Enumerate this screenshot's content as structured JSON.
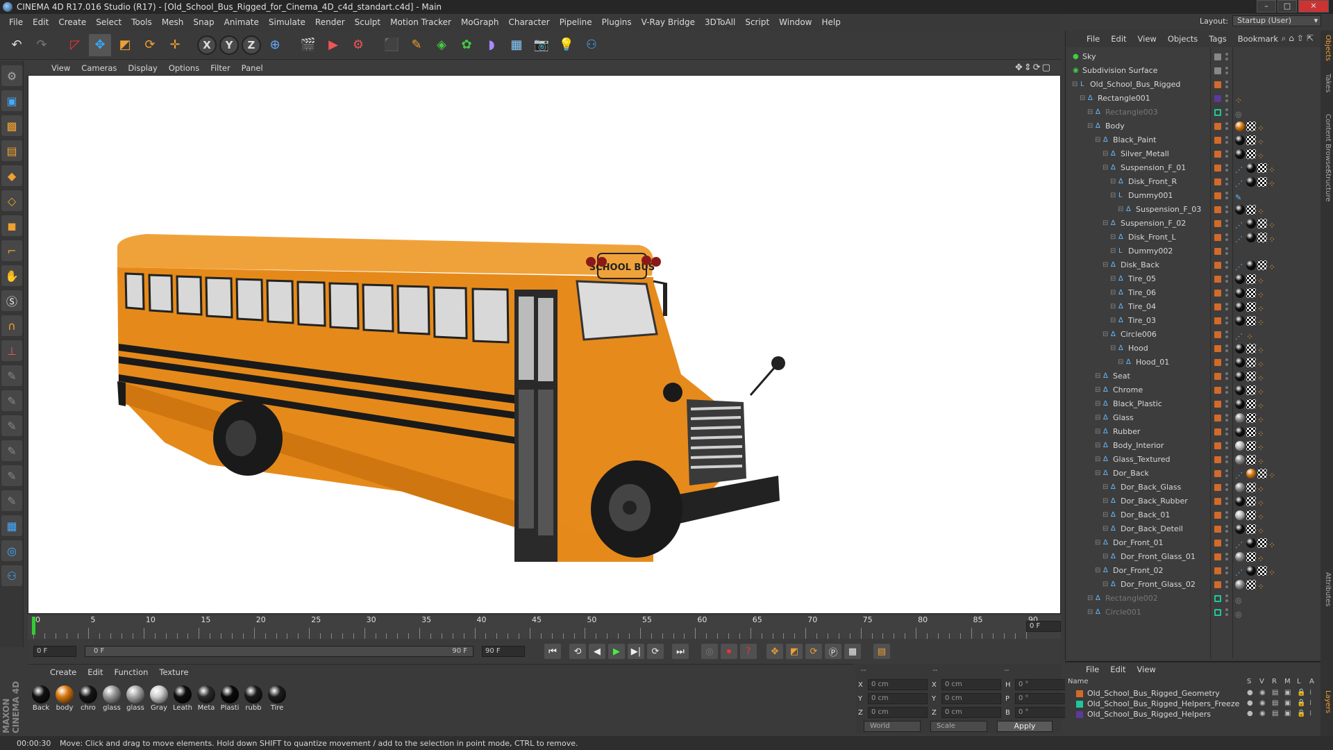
{
  "window": {
    "title": "CINEMA 4D R17.016 Studio (R17) - [Old_School_Bus_Rigged_for_Cinema_4D_c4d_standart.c4d] - Main",
    "layout_label": "Layout:",
    "layout_value": "Startup (User)"
  },
  "menu": [
    "File",
    "Edit",
    "Create",
    "Select",
    "Tools",
    "Mesh",
    "Snap",
    "Animate",
    "Simulate",
    "Render",
    "Sculpt",
    "Motion Tracker",
    "MoGraph",
    "Character",
    "Pipeline",
    "Plugins",
    "V-Ray Bridge",
    "3DToAll",
    "Script",
    "Window",
    "Help"
  ],
  "toolbar": {
    "axis_x": "X",
    "axis_y": "Y",
    "axis_z": "Z"
  },
  "viewport_menu": [
    "View",
    "Cameras",
    "Display",
    "Options",
    "Filter",
    "Panel"
  ],
  "timeline": {
    "ticks": [
      "0",
      "5",
      "10",
      "15",
      "20",
      "25",
      "30",
      "35",
      "40",
      "45",
      "50",
      "55",
      "60",
      "65",
      "70",
      "75",
      "80",
      "85",
      "90"
    ],
    "frame_display": "0 F",
    "start_field": "0 F",
    "range_start": "0 F",
    "range_end": "90 F",
    "end_field": "90 F"
  },
  "material_menu": [
    "Create",
    "Edit",
    "Function",
    "Texture"
  ],
  "materials": [
    {
      "label": "Back",
      "color": "#111111"
    },
    {
      "label": "body",
      "color": "#d9780f"
    },
    {
      "label": "chro",
      "color": "#151515"
    },
    {
      "label": "glass",
      "color": "#9a9a9a"
    },
    {
      "label": "glass",
      "color": "#a8a8a8"
    },
    {
      "label": "Gray",
      "color": "#cfcfcf"
    },
    {
      "label": "Leath",
      "color": "#0d0d0d"
    },
    {
      "label": "Meta",
      "color": "#2a2a2a"
    },
    {
      "label": "Plasti",
      "color": "#0a0a0a"
    },
    {
      "label": "rubb",
      "color": "#1a1a1a"
    },
    {
      "label": "Tire",
      "color": "#1c1c1c"
    }
  ],
  "coords": {
    "headers": [
      "--",
      "--",
      "--"
    ],
    "rows": [
      {
        "a1": "X",
        "v1": "0 cm",
        "a2": "X",
        "v2": "0 cm",
        "a3": "H",
        "v3": "0 °"
      },
      {
        "a1": "Y",
        "v1": "0 cm",
        "a2": "Y",
        "v2": "0 cm",
        "a3": "P",
        "v3": "0 °"
      },
      {
        "a1": "Z",
        "v1": "0 cm",
        "a2": "Z",
        "v2": "0 cm",
        "a3": "B",
        "v3": "0 °"
      }
    ],
    "mode1": "World",
    "mode2": "Scale",
    "apply": "Apply"
  },
  "status": {
    "time": "00:00:30",
    "message": "Move: Click and drag to move elements. Hold down SHIFT to quantize movement / add to the selection in point mode, CTRL to remove."
  },
  "object_menu": [
    "File",
    "Edit",
    "View",
    "Objects",
    "Tags",
    "Bookmark"
  ],
  "objects": [
    {
      "name": "Sky",
      "indent": 0,
      "icon": "sky",
      "dim": false,
      "swatch": "#888",
      "tags": []
    },
    {
      "name": "Subdivision Surface",
      "indent": 0,
      "icon": "subdiv",
      "dim": false,
      "swatch": "#888",
      "tags": []
    },
    {
      "name": "Old_School_Bus_Rigged",
      "indent": 1,
      "icon": "null",
      "dim": false,
      "swatch": "#d26a2a",
      "tags": []
    },
    {
      "name": "Rectangle001",
      "indent": 2,
      "icon": "spline",
      "dim": false,
      "swatch": "#5a3a9a",
      "tags": [
        "x"
      ]
    },
    {
      "name": "Rectangle003",
      "indent": 3,
      "icon": "spline",
      "dim": true,
      "swatch": "#1fc79a",
      "tags": [
        "o"
      ]
    },
    {
      "name": "Body",
      "indent": 3,
      "icon": "poly",
      "dim": false,
      "swatch": "#d26a2a",
      "tags": [
        "m-or",
        "c",
        "x"
      ]
    },
    {
      "name": "Black_Paint",
      "indent": 4,
      "icon": "poly",
      "dim": false,
      "swatch": "#d26a2a",
      "tags": [
        "m-bk",
        "c",
        "x"
      ]
    },
    {
      "name": "Silver_Metall",
      "indent": 5,
      "icon": "poly",
      "dim": false,
      "swatch": "#d26a2a",
      "tags": [
        "m-bk",
        "c",
        "x"
      ]
    },
    {
      "name": "Suspension_F_01",
      "indent": 5,
      "icon": "poly",
      "dim": false,
      "swatch": "#d26a2a",
      "tags": [
        "d",
        "m-bk",
        "c",
        "x"
      ]
    },
    {
      "name": "Disk_Front_R",
      "indent": 6,
      "icon": "poly",
      "dim": false,
      "swatch": "#d26a2a",
      "tags": [
        "d",
        "m-bk",
        "c",
        "x"
      ]
    },
    {
      "name": "Dummy001",
      "indent": 6,
      "icon": "null",
      "dim": false,
      "swatch": "#d26a2a",
      "tags": [
        "p"
      ]
    },
    {
      "name": "Suspension_F_03",
      "indent": 7,
      "icon": "poly",
      "dim": false,
      "swatch": "#d26a2a",
      "tags": [
        "m-bk",
        "c",
        "x"
      ]
    },
    {
      "name": "Suspension_F_02",
      "indent": 5,
      "icon": "poly",
      "dim": false,
      "swatch": "#d26a2a",
      "tags": [
        "d",
        "m-bk",
        "c",
        "x"
      ]
    },
    {
      "name": "Disk_Front_L",
      "indent": 6,
      "icon": "poly",
      "dim": false,
      "swatch": "#d26a2a",
      "tags": [
        "d",
        "m-bk",
        "c",
        "x"
      ]
    },
    {
      "name": "Dummy002",
      "indent": 6,
      "icon": "null",
      "dim": false,
      "swatch": "#d26a2a",
      "tags": []
    },
    {
      "name": "Disk_Back",
      "indent": 5,
      "icon": "poly",
      "dim": false,
      "swatch": "#d26a2a",
      "tags": [
        "d",
        "m-bk",
        "c",
        "x"
      ]
    },
    {
      "name": "Tire_05",
      "indent": 6,
      "icon": "poly",
      "dim": false,
      "swatch": "#d26a2a",
      "tags": [
        "m-bk",
        "c",
        "x"
      ]
    },
    {
      "name": "Tire_06",
      "indent": 6,
      "icon": "poly",
      "dim": false,
      "swatch": "#d26a2a",
      "tags": [
        "m-bk",
        "c",
        "x"
      ]
    },
    {
      "name": "Tire_04",
      "indent": 6,
      "icon": "poly",
      "dim": false,
      "swatch": "#d26a2a",
      "tags": [
        "m-bk",
        "c",
        "x"
      ]
    },
    {
      "name": "Tire_03",
      "indent": 6,
      "icon": "poly",
      "dim": false,
      "swatch": "#d26a2a",
      "tags": [
        "m-bk",
        "c",
        "x"
      ]
    },
    {
      "name": "Circle006",
      "indent": 5,
      "icon": "spline",
      "dim": false,
      "swatch": "#d26a2a",
      "tags": [
        "d",
        "x"
      ]
    },
    {
      "name": "Hood",
      "indent": 6,
      "icon": "poly",
      "dim": false,
      "swatch": "#d26a2a",
      "tags": [
        "m-bk",
        "c",
        "x"
      ]
    },
    {
      "name": "Hood_01",
      "indent": 7,
      "icon": "poly",
      "dim": false,
      "swatch": "#d26a2a",
      "tags": [
        "m-bk",
        "c",
        "x"
      ]
    },
    {
      "name": "Seat",
      "indent": 4,
      "icon": "poly",
      "dim": false,
      "swatch": "#d26a2a",
      "tags": [
        "m-bk",
        "c",
        "x"
      ]
    },
    {
      "name": "Chrome",
      "indent": 4,
      "icon": "poly",
      "dim": false,
      "swatch": "#d26a2a",
      "tags": [
        "m-bk",
        "c",
        "x"
      ]
    },
    {
      "name": "Black_Plastic",
      "indent": 4,
      "icon": "poly",
      "dim": false,
      "swatch": "#d26a2a",
      "tags": [
        "m-bk",
        "c",
        "x"
      ]
    },
    {
      "name": "Glass",
      "indent": 4,
      "icon": "poly",
      "dim": false,
      "swatch": "#d26a2a",
      "tags": [
        "m-gl",
        "c",
        "x"
      ]
    },
    {
      "name": "Rubber",
      "indent": 4,
      "icon": "poly",
      "dim": false,
      "swatch": "#d26a2a",
      "tags": [
        "m-bk",
        "c",
        "x"
      ]
    },
    {
      "name": "Body_Interior",
      "indent": 4,
      "icon": "poly",
      "dim": false,
      "swatch": "#d26a2a",
      "tags": [
        "m-gr",
        "c",
        "x"
      ]
    },
    {
      "name": "Glass_Textured",
      "indent": 4,
      "icon": "poly",
      "dim": false,
      "swatch": "#d26a2a",
      "tags": [
        "m-gl",
        "c",
        "x"
      ]
    },
    {
      "name": "Dor_Back",
      "indent": 4,
      "icon": "poly",
      "dim": false,
      "swatch": "#d26a2a",
      "tags": [
        "d",
        "m-or",
        "c",
        "x"
      ]
    },
    {
      "name": "Dor_Back_Glass",
      "indent": 5,
      "icon": "poly",
      "dim": false,
      "swatch": "#d26a2a",
      "tags": [
        "m-gl",
        "c",
        "x"
      ]
    },
    {
      "name": "Dor_Back_Rubber",
      "indent": 5,
      "icon": "poly",
      "dim": false,
      "swatch": "#d26a2a",
      "tags": [
        "m-bk",
        "c",
        "x"
      ]
    },
    {
      "name": "Dor_Back_01",
      "indent": 5,
      "icon": "poly",
      "dim": false,
      "swatch": "#d26a2a",
      "tags": [
        "m-gr",
        "c",
        "x"
      ]
    },
    {
      "name": "Dor_Back_Deteil",
      "indent": 5,
      "icon": "poly",
      "dim": false,
      "swatch": "#d26a2a",
      "tags": [
        "m-bk",
        "c",
        "x"
      ]
    },
    {
      "name": "Dor_Front_01",
      "indent": 4,
      "icon": "poly",
      "dim": false,
      "swatch": "#d26a2a",
      "tags": [
        "d",
        "m-bk",
        "c",
        "x"
      ]
    },
    {
      "name": "Dor_Front_Glass_01",
      "indent": 5,
      "icon": "poly",
      "dim": false,
      "swatch": "#d26a2a",
      "tags": [
        "m-gl",
        "c",
        "x"
      ]
    },
    {
      "name": "Dor_Front_02",
      "indent": 4,
      "icon": "poly",
      "dim": false,
      "swatch": "#d26a2a",
      "tags": [
        "d",
        "m-bk",
        "c",
        "x"
      ]
    },
    {
      "name": "Dor_Front_Glass_02",
      "indent": 5,
      "icon": "poly",
      "dim": false,
      "swatch": "#d26a2a",
      "tags": [
        "m-gl",
        "c",
        "x"
      ]
    },
    {
      "name": "Rectangle002",
      "indent": 3,
      "icon": "spline",
      "dim": true,
      "swatch": "#1fc79a",
      "tags": [
        "o"
      ]
    },
    {
      "name": "Circle001",
      "indent": 3,
      "icon": "spline",
      "dim": true,
      "swatch": "#1fc79a",
      "tags": [
        "o"
      ]
    }
  ],
  "side_tabs": [
    "Objects",
    "Takes",
    "Content Browser",
    "Structure",
    "Attributes",
    "Layers"
  ],
  "layer_menu": [
    "File",
    "Edit",
    "View"
  ],
  "layer_header": {
    "name": "Name",
    "cols": [
      "S",
      "V",
      "R",
      "M",
      "L",
      "A"
    ]
  },
  "layers": [
    {
      "name": "Old_School_Bus_Rigged_Geometry",
      "color": "#d26a2a"
    },
    {
      "name": "Old_School_Bus_Rigged_Helpers_Freeze",
      "color": "#1fc79a"
    },
    {
      "name": "Old_School_Bus_Rigged_Helpers",
      "color": "#5a3a9a"
    }
  ],
  "bus": {
    "sign_text": "SCHOOL BUS"
  },
  "brand": "MAXON CINEMA 4D"
}
